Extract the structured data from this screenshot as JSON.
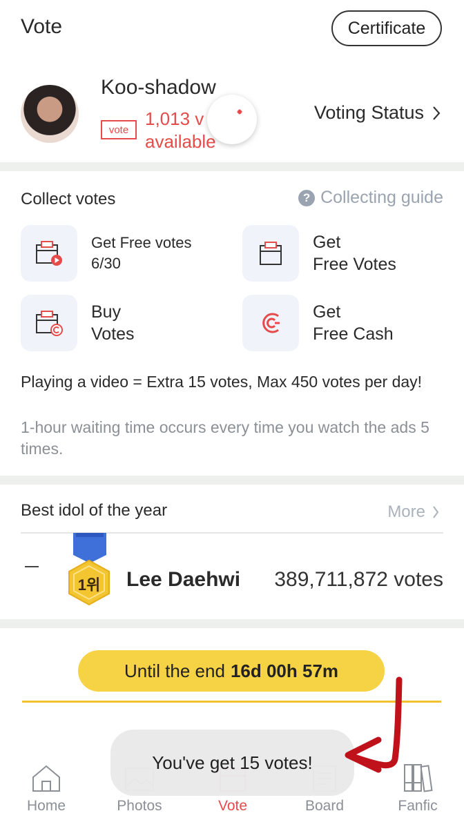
{
  "header": {
    "title": "Vote",
    "certificate_label": "Certificate"
  },
  "profile": {
    "username": "Koo-shadow",
    "vote_tag": "vote",
    "votes_line1": "1,013 v",
    "votes_line2": "available",
    "voting_status_label": "Voting Status"
  },
  "collect": {
    "title": "Collect votes",
    "guide_label": "Collecting guide",
    "tiles": [
      {
        "line1": "Get Free votes",
        "line2": "6/30",
        "icon": "video-vote-icon"
      },
      {
        "line1": "Get",
        "line2": "Free Votes",
        "icon": "vote-box-icon"
      },
      {
        "line1": "Buy",
        "line2": "Votes",
        "icon": "vote-coin-icon"
      },
      {
        "line1": "Get",
        "line2": "Free Cash",
        "icon": "cash-icon"
      }
    ],
    "tip_main": "Playing a video = Extra 15 votes, Max 450 votes per day!",
    "tip_sub": "1-hour waiting time occurs every time you watch the ads 5 times."
  },
  "best_idol": {
    "title": "Best idol of the year",
    "more_label": "More",
    "rank_badge": "1위",
    "rank_change": "—",
    "name": "Lee Daehwi",
    "votes": "389,711,872 votes"
  },
  "countdown": {
    "prefix": "Until the end",
    "value": "16d 00h 57m"
  },
  "toast": {
    "message": "You've get 15 votes!"
  },
  "tabbar": {
    "tabs": [
      {
        "label": "Home"
      },
      {
        "label": "Photos"
      },
      {
        "label": "Vote"
      },
      {
        "label": "Board"
      },
      {
        "label": "Fanfic"
      }
    ],
    "active": "Vote"
  },
  "colors": {
    "accent_red": "#e54b4b",
    "yellow": "#f6d245",
    "tile_bg": "#f0f4fa",
    "annotation": "#c0121a"
  }
}
